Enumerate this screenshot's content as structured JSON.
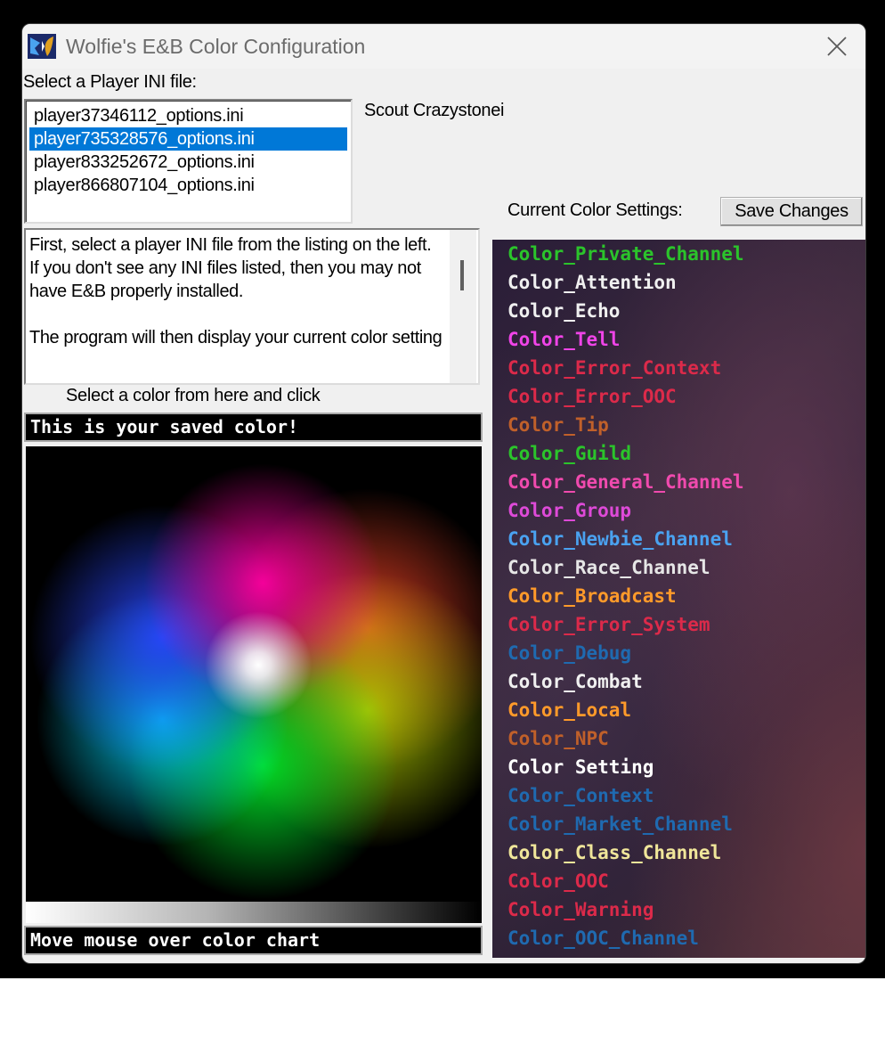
{
  "window": {
    "title": "Wolfie's E&B Color Configuration"
  },
  "select_label": "Select a Player INI file:",
  "files": [
    "player37346112_options.ini",
    "player735328576_options.ini",
    "player833252672_options.ini",
    "player866807104_options.ini"
  ],
  "selected_file_index": 1,
  "character_name": "Scout Crazystonei",
  "current_settings_label": "Current Color Settings:",
  "save_button_label": "Save Changes",
  "help_text": "First, select a player INI file from the listing on the left.  If you don't see any INI files listed, then you may not have E&B properly installed.\n\nThe program will then display your current color setting",
  "select_color_hint": "Select a color from here and click",
  "saved_color_text": "This is your saved color!",
  "hover_text": "Move mouse over color chart",
  "color_settings": [
    {
      "name": "Color_Private_Channel",
      "color": "#2bc42b"
    },
    {
      "name": "Color_Attention",
      "color": "#f0f0f0"
    },
    {
      "name": "Color_Echo",
      "color": "#f0f0f0"
    },
    {
      "name": "Color_Tell",
      "color": "#f044e8"
    },
    {
      "name": "Color_Error_Context",
      "color": "#dc2a4a"
    },
    {
      "name": "Color_Error_OOC",
      "color": "#dc2a4a"
    },
    {
      "name": "Color_Tip",
      "color": "#c0602a"
    },
    {
      "name": "Color_Guild",
      "color": "#2bc42b"
    },
    {
      "name": "Color_General_Channel",
      "color": "#f04aae"
    },
    {
      "name": "Color_Group",
      "color": "#de4ad8"
    },
    {
      "name": "Color_Newbie_Channel",
      "color": "#4aa2f0"
    },
    {
      "name": "Color_Race_Channel",
      "color": "#e6e6e6"
    },
    {
      "name": "Color_Broadcast",
      "color": "#ff9a2a"
    },
    {
      "name": "Color_Error_System",
      "color": "#dc2a4a"
    },
    {
      "name": "Color_Debug",
      "color": "#1f6ab0"
    },
    {
      "name": "Color_Combat",
      "color": "#f0f0f0"
    },
    {
      "name": "Color_Local",
      "color": "#ff9a2a"
    },
    {
      "name": "Color_NPC",
      "color": "#c0602a"
    },
    {
      "name": "Color Setting",
      "color": "#ffffff"
    },
    {
      "name": "Color_Context",
      "color": "#1f6ab0"
    },
    {
      "name": "Color_Market_Channel",
      "color": "#1f6ab0"
    },
    {
      "name": "Color_Class_Channel",
      "color": "#f0e69a"
    },
    {
      "name": "Color_OOC",
      "color": "#dc2a4a"
    },
    {
      "name": "Color_Warning",
      "color": "#dc2a4a"
    },
    {
      "name": "Color_OOC_Channel",
      "color": "#1f6ab0"
    }
  ]
}
